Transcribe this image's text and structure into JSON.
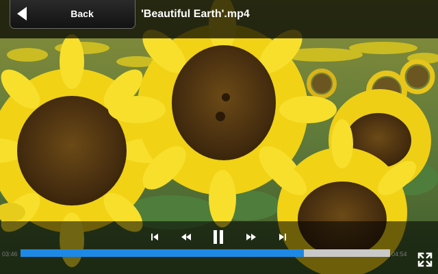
{
  "header": {
    "back_label": "Back",
    "title": "'Beautiful Earth'.mp4"
  },
  "video": {
    "scene": "sunflowers"
  },
  "controls": {
    "buttons": [
      "previous-icon",
      "rewind-icon",
      "pause-icon",
      "fast-forward-icon",
      "next-icon"
    ],
    "elapsed": "03:46",
    "total": "04:54",
    "progress": 0.766,
    "accent_color": "#1e88e5"
  },
  "fullscreen_icon": "fullscreen-icon"
}
